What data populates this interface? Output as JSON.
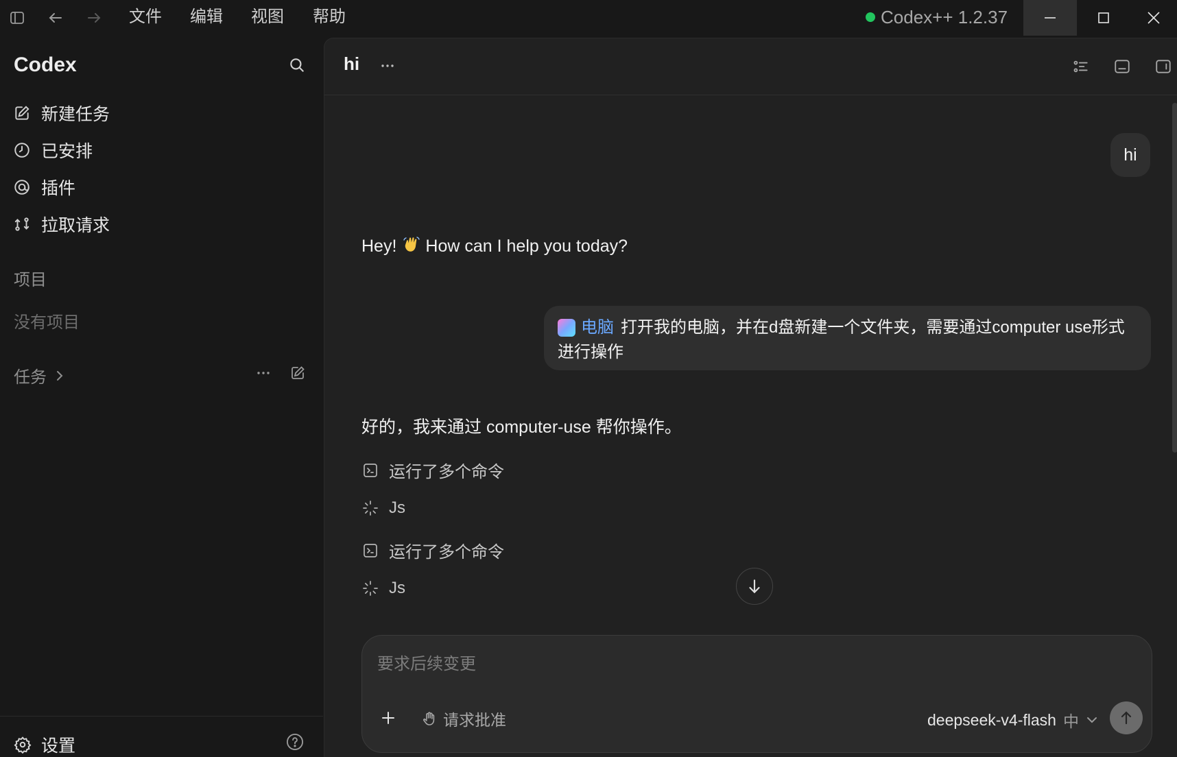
{
  "titlebar": {
    "menus": [
      "文件",
      "编辑",
      "视图",
      "帮助"
    ],
    "app_version": "Codex++ 1.2.37",
    "status_color": "#22c55e"
  },
  "sidebar": {
    "title": "Codex",
    "nav": [
      {
        "label": "新建任务",
        "icon": "new-task-icon"
      },
      {
        "label": "已安排",
        "icon": "clock-icon"
      },
      {
        "label": "插件",
        "icon": "plugin-icon"
      },
      {
        "label": "拉取请求",
        "icon": "pull-request-icon"
      }
    ],
    "projects_heading": "项目",
    "projects_empty": "没有项目",
    "tasks_heading": "任务",
    "settings_label": "设置"
  },
  "thread": {
    "title": "hi",
    "messages": {
      "user_1": "hi",
      "assistant_1_before": "Hey!",
      "assistant_1_after": "How can I help you today?",
      "user_2_plugin": "电脑",
      "user_2_text": "打开我的电脑，并在d盘新建一个文件夹，需要通过computer use形式进行操作",
      "assistant_2": "好的，我来通过 computer-use 帮你操作。"
    },
    "steps": [
      {
        "label": "运行了多个命令",
        "icon": "terminal-icon"
      },
      {
        "label": "Js",
        "icon": "loading-icon"
      },
      {
        "label": "运行了多个命令",
        "icon": "terminal-icon"
      },
      {
        "label": "Js",
        "icon": "loading-icon"
      }
    ]
  },
  "composer": {
    "placeholder": "要求后续变更",
    "approval_label": "请求批准",
    "model": "deepseek-v4-flash",
    "effort": "中"
  }
}
